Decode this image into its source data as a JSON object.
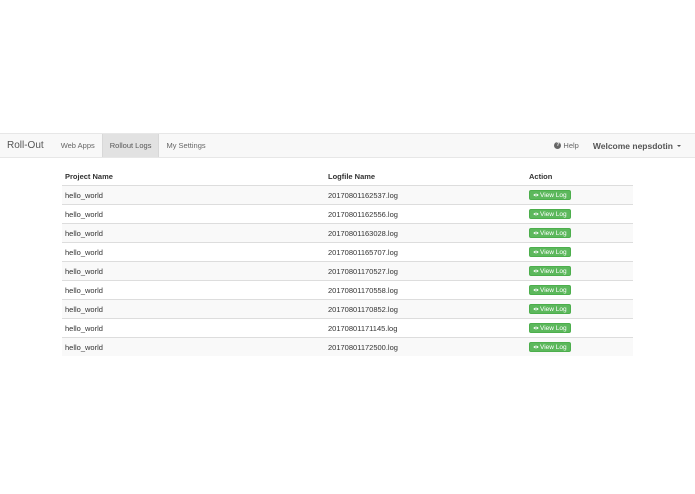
{
  "navbar": {
    "brand": "Roll-Out",
    "links": [
      {
        "label": "Web Apps",
        "active": false
      },
      {
        "label": "Rollout Logs",
        "active": true
      },
      {
        "label": "My Settings",
        "active": false
      }
    ],
    "help_label": "Help",
    "help_icon": "question-circle-icon",
    "welcome_label": "Welcome nepsdotin"
  },
  "table": {
    "headers": {
      "project": "Project Name",
      "logfile": "Logfile Name",
      "action": "Action"
    },
    "button_label": "View Log",
    "button_icon": "eye-icon",
    "button_color": "#5cb85c",
    "rows": [
      {
        "project": "hello_world",
        "logfile": "20170801162537.log"
      },
      {
        "project": "hello_world",
        "logfile": "20170801162556.log"
      },
      {
        "project": "hello_world",
        "logfile": "20170801163028.log"
      },
      {
        "project": "hello_world",
        "logfile": "20170801165707.log"
      },
      {
        "project": "hello_world",
        "logfile": "20170801170527.log"
      },
      {
        "project": "hello_world",
        "logfile": "20170801170558.log"
      },
      {
        "project": "hello_world",
        "logfile": "20170801170852.log"
      },
      {
        "project": "hello_world",
        "logfile": "20170801171145.log"
      },
      {
        "project": "hello_world",
        "logfile": "20170801172500.log"
      }
    ]
  }
}
